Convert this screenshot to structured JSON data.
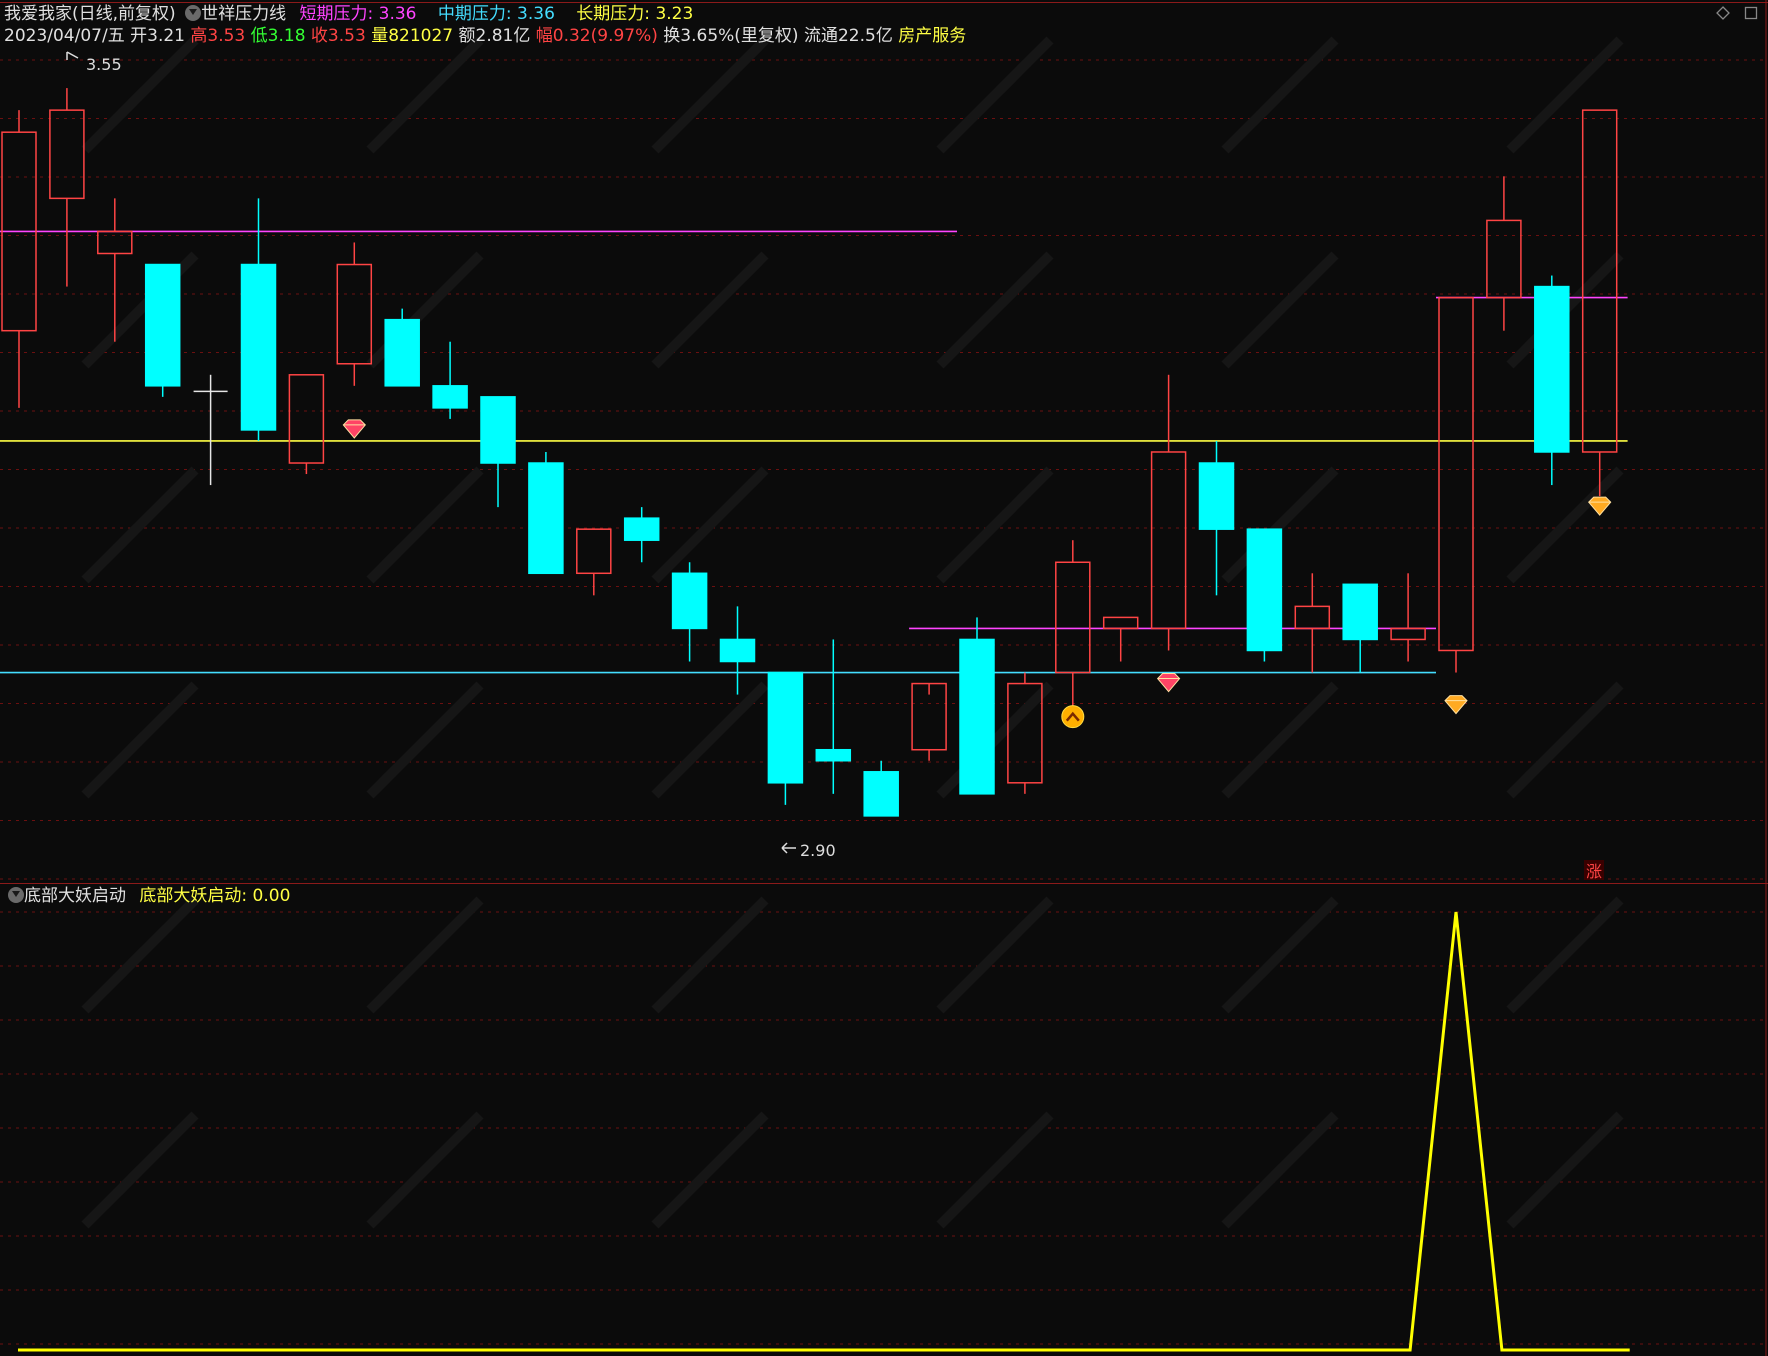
{
  "header": {
    "stock_name": "我爱我家",
    "period": "(日线,前复权)",
    "indicator_name": "世祥压力线",
    "short_label": "短期压力:",
    "short_value": "3.36",
    "mid_label": "中期压力:",
    "mid_value": "3.36",
    "long_label": "长期压力:",
    "long_value": "3.23"
  },
  "quote": {
    "date": "2023/04/07/五",
    "open_label": "开",
    "open": "3.21",
    "high_label": "高",
    "high": "3.53",
    "low_label": "低",
    "low": "3.18",
    "close_label": "收",
    "close": "3.53",
    "volume_label": "量",
    "volume": "821027",
    "amount_label": "额",
    "amount": "2.81亿",
    "change_label": "幅",
    "change": "0.32(9.97%)",
    "turnover": "换3.65%(里复权)",
    "float_label": "流通",
    "float": "22.5亿",
    "sector": "房产服务"
  },
  "annotations": {
    "max_label": "3.55",
    "min_label": "2.90",
    "limit_up_badge": "涨"
  },
  "sub_panel": {
    "name": "底部大妖启动",
    "series_label": "底部大妖启动:",
    "series_value": "0.00"
  },
  "colors": {
    "up": "#ff4444",
    "down": "#00ffff",
    "short_pressure": "#ff44ff",
    "mid_pressure": "#44ddff",
    "long_pressure": "#ffff44",
    "signal_line": "#ffff00",
    "grid": "#6b1010"
  },
  "chart_data": [
    {
      "type": "candlestick",
      "ylim": [
        2.85,
        3.58
      ],
      "candles": [
        {
          "o": 3.33,
          "h": 3.53,
          "l": 3.26,
          "c": 3.51
        },
        {
          "o": 3.45,
          "h": 3.55,
          "l": 3.37,
          "c": 3.53
        },
        {
          "o": 3.4,
          "h": 3.45,
          "l": 3.32,
          "c": 3.42
        },
        {
          "o": 3.39,
          "h": 3.39,
          "l": 3.27,
          "c": 3.28
        },
        {
          "o": 3.275,
          "h": 3.29,
          "l": 3.19,
          "c": 3.275
        },
        {
          "o": 3.39,
          "h": 3.45,
          "l": 3.23,
          "c": 3.24
        },
        {
          "o": 3.21,
          "h": 3.29,
          "l": 3.2,
          "c": 3.29
        },
        {
          "o": 3.3,
          "h": 3.41,
          "l": 3.28,
          "c": 3.39
        },
        {
          "o": 3.34,
          "h": 3.35,
          "l": 3.28,
          "c": 3.28
        },
        {
          "o": 3.28,
          "h": 3.32,
          "l": 3.25,
          "c": 3.26
        },
        {
          "o": 3.27,
          "h": 3.27,
          "l": 3.17,
          "c": 3.21
        },
        {
          "o": 3.21,
          "h": 3.22,
          "l": 3.11,
          "c": 3.11
        },
        {
          "o": 3.11,
          "h": 3.15,
          "l": 3.09,
          "c": 3.15
        },
        {
          "o": 3.16,
          "h": 3.17,
          "l": 3.12,
          "c": 3.14
        },
        {
          "o": 3.11,
          "h": 3.12,
          "l": 3.03,
          "c": 3.06
        },
        {
          "o": 3.05,
          "h": 3.08,
          "l": 3.0,
          "c": 3.03
        },
        {
          "o": 3.02,
          "h": 3.02,
          "l": 2.9,
          "c": 2.92
        },
        {
          "o": 2.95,
          "h": 3.05,
          "l": 2.91,
          "c": 2.94
        },
        {
          "o": 2.93,
          "h": 2.94,
          "l": 2.89,
          "c": 2.89
        },
        {
          "o": 2.95,
          "h": 3.0,
          "l": 2.94,
          "c": 3.01
        },
        {
          "o": 3.05,
          "h": 3.07,
          "l": 2.91,
          "c": 2.91
        },
        {
          "o": 2.92,
          "h": 3.02,
          "l": 2.91,
          "c": 3.01
        },
        {
          "o": 3.02,
          "h": 3.14,
          "l": 2.97,
          "c": 3.12
        },
        {
          "o": 3.06,
          "h": 3.07,
          "l": 3.03,
          "c": 3.07
        },
        {
          "o": 3.06,
          "h": 3.29,
          "l": 3.04,
          "c": 3.22
        },
        {
          "o": 3.21,
          "h": 3.23,
          "l": 3.09,
          "c": 3.15
        },
        {
          "o": 3.15,
          "h": 3.15,
          "l": 3.03,
          "c": 3.04
        },
        {
          "o": 3.06,
          "h": 3.11,
          "l": 3.02,
          "c": 3.08
        },
        {
          "o": 3.1,
          "h": 3.1,
          "l": 3.02,
          "c": 3.05
        },
        {
          "o": 3.05,
          "h": 3.11,
          "l": 3.03,
          "c": 3.06
        },
        {
          "o": 3.04,
          "h": 3.36,
          "l": 3.02,
          "c": 3.36
        },
        {
          "o": 3.36,
          "h": 3.47,
          "l": 3.33,
          "c": 3.43
        },
        {
          "o": 3.37,
          "h": 3.38,
          "l": 3.19,
          "c": 3.22
        },
        {
          "o": 3.22,
          "h": 3.53,
          "l": 3.18,
          "c": 3.53
        }
      ],
      "pressure_lines": [
        {
          "name": "短期压力",
          "value": 3.36,
          "from": 30,
          "to": 34
        },
        {
          "name": "短期压力",
          "value": 3.06,
          "from": 19,
          "to": 30
        },
        {
          "name": "短期压力",
          "value": 3.42,
          "from": 0,
          "to": 20
        },
        {
          "name": "长期压力",
          "value": 3.23,
          "from": 0,
          "to": 34
        },
        {
          "name": "中期压力",
          "value": 3.02,
          "from": 0,
          "to": 30
        }
      ],
      "markers": [
        {
          "index": 7,
          "kind": "gem-red",
          "value": 3.24
        },
        {
          "index": 22,
          "kind": "up-arrow",
          "value": 2.98
        },
        {
          "index": 24,
          "kind": "gem-red",
          "value": 3.01
        },
        {
          "index": 30,
          "kind": "gem-orange",
          "value": 2.99
        },
        {
          "index": 33,
          "kind": "gem-orange",
          "value": 3.17
        }
      ]
    },
    {
      "type": "line",
      "name": "底部大妖启动",
      "ylim": [
        0,
        1
      ],
      "x": [
        0,
        29,
        30,
        31,
        33
      ],
      "values": [
        0,
        0,
        1,
        0,
        0
      ]
    }
  ]
}
